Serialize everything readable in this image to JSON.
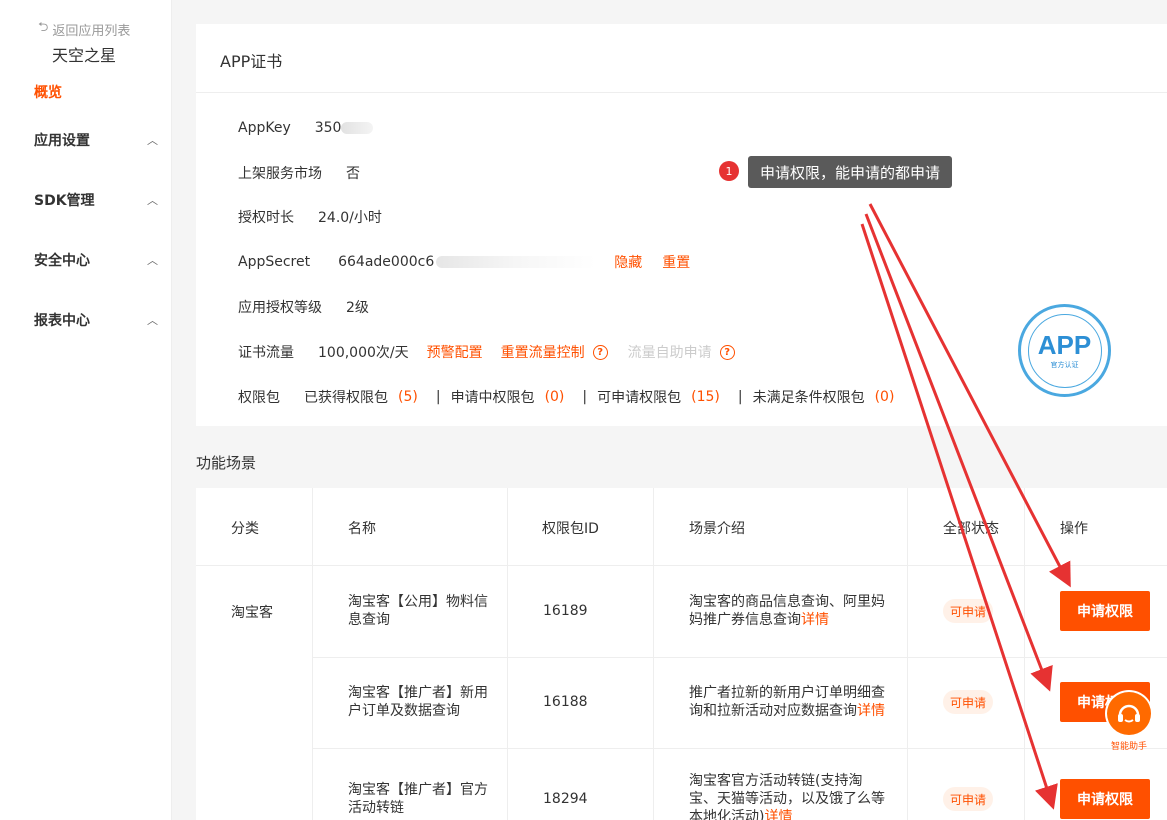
{
  "sidebar": {
    "back_label": "返回应用列表",
    "app_name": "天空之星",
    "overview": "概览",
    "groups": [
      {
        "label": "应用设置"
      },
      {
        "label": "SDK管理"
      },
      {
        "label": "安全中心"
      },
      {
        "label": "报表中心"
      }
    ]
  },
  "cert": {
    "title": "APP证书",
    "appkey_label": "AppKey",
    "appkey_value": "350",
    "market_label": "上架服务市场",
    "market_value": "否",
    "duration_label": "授权时长",
    "duration_value": "24.0/小时",
    "secret_label": "AppSecret",
    "secret_value": "664ade000c6",
    "secret_hide": "隐藏",
    "secret_reset": "重置",
    "level_label": "应用授权等级",
    "level_value": "2级",
    "traffic_label": "证书流量",
    "traffic_value": "100,000次/天",
    "traffic_alert": "预警配置",
    "traffic_reset": "重置流量控制",
    "traffic_self": "流量自助申请",
    "perm_label": "权限包",
    "perm_obtained": "已获得权限包",
    "perm_obtained_count": "(5)",
    "perm_applying": "申请中权限包",
    "perm_applying_count": "(0)",
    "perm_available": "可申请权限包",
    "perm_available_count": "(15)",
    "perm_unmet": "未满足条件权限包",
    "perm_unmet_count": "(0)"
  },
  "callout": {
    "number": "1",
    "text": "申请权限，能申请的都申请"
  },
  "stamp": {
    "main": "APP",
    "sub": "官方认证"
  },
  "scenes": {
    "title": "功能场景",
    "columns": [
      "分类",
      "名称",
      "权限包ID",
      "场景介绍",
      "全部状态",
      "操作"
    ],
    "category": "淘宝客",
    "rows": [
      {
        "name_1": "淘宝客【公用】物料信",
        "name_2": "息查询",
        "id": "16189",
        "desc_1": "淘宝客的商品信息查询、阿里妈",
        "desc_2": "妈推广券信息查询",
        "detail": "详情",
        "status": "可申请",
        "action": "申请权限"
      },
      {
        "name_1": "淘宝客【推广者】新用",
        "name_2": "户订单及数据查询",
        "id": "16188",
        "desc_1": "推广者拉新的新用户订单明细查",
        "desc_2": "询和拉新活动对应数据查询",
        "detail": "详情",
        "status": "可申请",
        "action": "申请权限"
      },
      {
        "name_1": "淘宝客【推广者】官方",
        "name_2": "活动转链",
        "id": "18294",
        "desc_1": "淘宝客官方活动转链(支持淘",
        "desc_2": "宝、天猫等活动，以及饿了么等",
        "desc_3": "本地化活动)",
        "detail": "详情",
        "status": "可申请",
        "action": "申请权限"
      }
    ]
  },
  "assistant": {
    "label": "智能助手"
  },
  "colors": {
    "accent": "#ff5000",
    "arrow": "#e63232",
    "stamp": "#4aa8e0"
  }
}
